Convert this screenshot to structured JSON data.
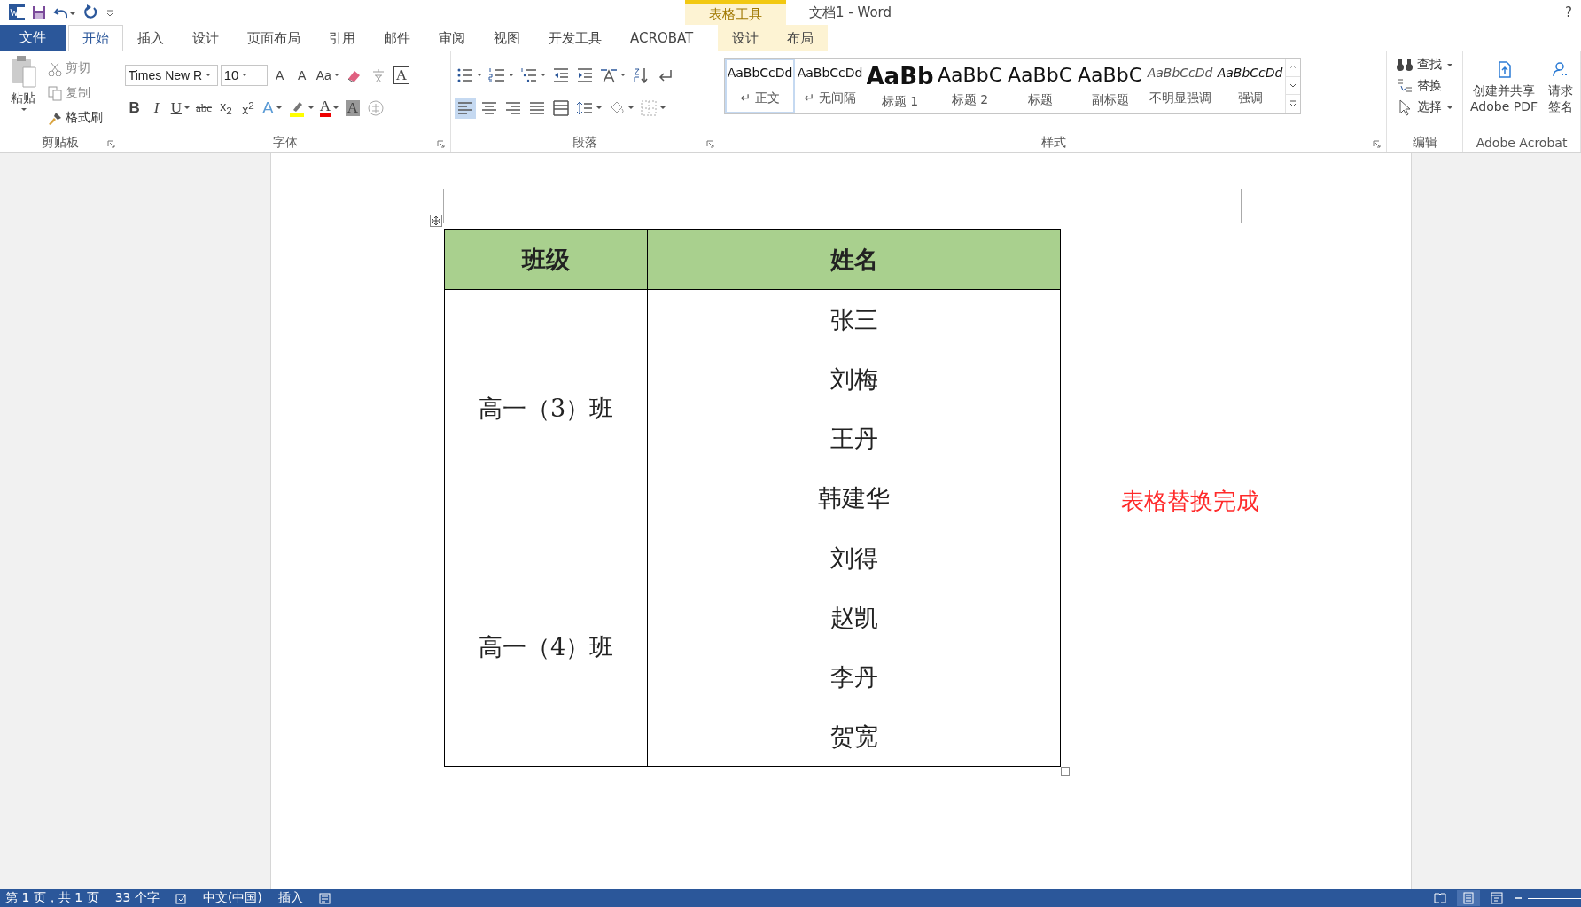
{
  "window": {
    "title": "文档1 - Word",
    "context_label": "表格工具",
    "help": "?"
  },
  "tabs": [
    {
      "label": "文件",
      "kind": "file",
      "selected": false
    },
    {
      "label": "开始",
      "kind": "normal",
      "selected": true
    },
    {
      "label": "插入",
      "kind": "normal",
      "selected": false
    },
    {
      "label": "设计",
      "kind": "normal",
      "selected": false
    },
    {
      "label": "页面布局",
      "kind": "normal",
      "selected": false
    },
    {
      "label": "引用",
      "kind": "normal",
      "selected": false
    },
    {
      "label": "邮件",
      "kind": "normal",
      "selected": false
    },
    {
      "label": "审阅",
      "kind": "normal",
      "selected": false
    },
    {
      "label": "视图",
      "kind": "normal",
      "selected": false
    },
    {
      "label": "开发工具",
      "kind": "normal",
      "selected": false
    },
    {
      "label": "ACROBAT",
      "kind": "normal",
      "selected": false
    },
    {
      "label": "设计",
      "kind": "context",
      "selected": false
    },
    {
      "label": "布局",
      "kind": "context",
      "selected": false
    }
  ],
  "clipboard": {
    "paste": "粘贴",
    "cut": "剪切",
    "copy": "复制",
    "painter": "格式刷",
    "label": "剪贴板"
  },
  "font": {
    "name": "Times New R",
    "size": "10",
    "label": "字体",
    "row1": [
      {
        "kind": "grow",
        "label": "A"
      },
      {
        "kind": "shrink",
        "label": "A"
      },
      {
        "kind": "case",
        "label": "Aa",
        "menu": true
      },
      {
        "kind": "clear"
      },
      {
        "kind": "phonetic"
      },
      {
        "kind": "border",
        "label": "A"
      }
    ],
    "row2": [
      {
        "kind": "bold",
        "label": "B"
      },
      {
        "kind": "italic",
        "label": "I"
      },
      {
        "kind": "underline",
        "label": "U",
        "menu": true
      },
      {
        "kind": "strike",
        "label": "abc"
      },
      {
        "kind": "sub",
        "label": "x$_{2}$"
      },
      {
        "kind": "sup",
        "label": "x$^{2}$"
      },
      {
        "kind": "effects",
        "label": "A",
        "menu": true
      },
      {
        "kind": "highlight",
        "menu": true
      },
      {
        "kind": "color",
        "label": "A",
        "menu": true
      },
      {
        "kind": "shade",
        "label": "A"
      },
      {
        "kind": "enclose"
      }
    ]
  },
  "paragraph": {
    "label": "段落",
    "row1": [
      {
        "kind": "bullets",
        "menu": true
      },
      {
        "kind": "numbering",
        "menu": true
      },
      {
        "kind": "multilevel",
        "menu": true
      },
      {
        "kind": "outdent"
      },
      {
        "kind": "indent"
      },
      {
        "kind": "asian",
        "menu": true
      },
      {
        "kind": "sort"
      },
      {
        "kind": "marks"
      }
    ],
    "row2": [
      {
        "kind": "left",
        "selected": true
      },
      {
        "kind": "center",
        "selected": false
      },
      {
        "kind": "right",
        "selected": false
      },
      {
        "kind": "justify",
        "selected": false
      },
      {
        "kind": "distribute",
        "selected": false
      },
      {
        "kind": "spacing",
        "menu": true
      },
      {
        "kind": "fill",
        "menu": true
      },
      {
        "kind": "borders",
        "menu": true
      }
    ]
  },
  "styles": {
    "label": "样式",
    "items": [
      {
        "preview": "AaBbCcDd",
        "name": "↵ 正文",
        "kind": "normal",
        "selected": true
      },
      {
        "preview": "AaBbCcDd",
        "name": "↵ 无间隔",
        "kind": "normal",
        "selected": false
      },
      {
        "preview": "AaBb",
        "name": "标题 1",
        "kind": "heading1",
        "selected": false
      },
      {
        "preview": "AaBbC",
        "name": "标题 2",
        "kind": "heading2",
        "selected": false
      },
      {
        "preview": "AaBbC",
        "name": "标题",
        "kind": "title",
        "selected": false
      },
      {
        "preview": "AaBbC",
        "name": "副标题",
        "kind": "title",
        "selected": false
      },
      {
        "preview": "AaBbCcDd",
        "name": "不明显强调",
        "kind": "subtle",
        "selected": false
      },
      {
        "preview": "AaBbCcDd",
        "name": "强调",
        "kind": "emphasis",
        "selected": false
      }
    ]
  },
  "editing": {
    "label": "编辑",
    "items": [
      {
        "kind": "find",
        "label": "查找",
        "menu": true
      },
      {
        "kind": "replace",
        "label": "替换"
      },
      {
        "kind": "select",
        "label": "选择",
        "menu": true
      }
    ]
  },
  "acrobat": {
    "label": "Adobe Acrobat",
    "items": [
      {
        "kind": "pdf",
        "lines": [
          "创建并共享",
          "Adobe PDF"
        ]
      },
      {
        "kind": "sign",
        "lines": [
          "请求",
          "签名"
        ]
      }
    ]
  },
  "table": {
    "columns": [
      "班级",
      "姓名"
    ],
    "groups": [
      {
        "class": "高一（3）班",
        "names": [
          "张三",
          "刘梅",
          "王丹",
          "韩建华"
        ]
      },
      {
        "class": "高一（4）班",
        "names": [
          "刘得",
          "赵凯",
          "李丹",
          "贺宽"
        ]
      }
    ]
  },
  "note": "表格替换完成",
  "status_bar": {
    "items": [
      "第 1 页，共 1 页",
      "33 个字",
      "中文(中国)",
      "插入"
    ],
    "views": [
      {
        "kind": "read",
        "selected": false
      },
      {
        "kind": "print",
        "selected": true
      },
      {
        "kind": "web",
        "selected": false
      }
    ]
  }
}
